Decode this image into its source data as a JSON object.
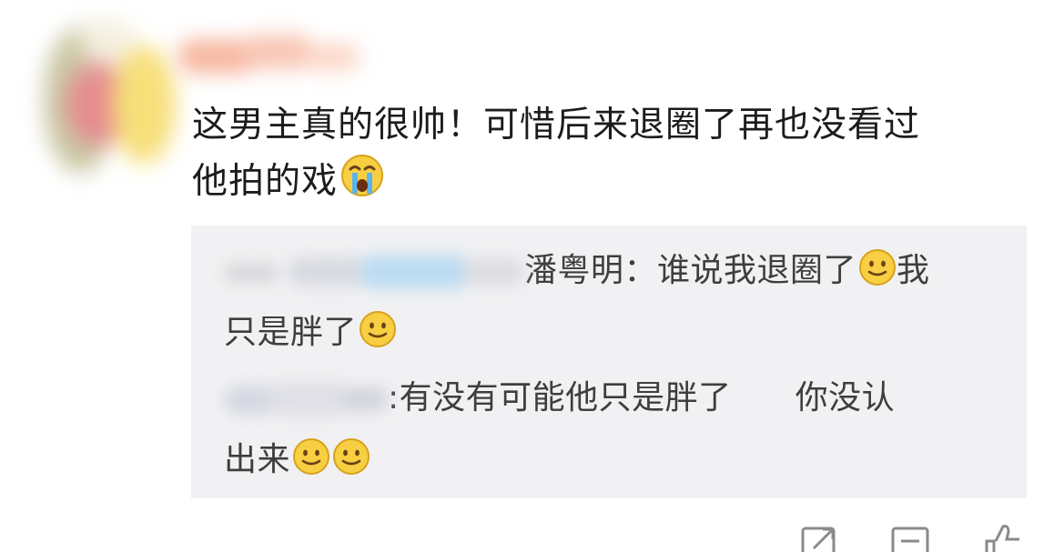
{
  "comment": {
    "text_line1": "这男主真的很帅！可惜后来退圈了再也没看过",
    "text_line2": "他拍的戏",
    "emoji": "crying-face"
  },
  "replies": [
    {
      "author": "潘粤明",
      "colon": "：",
      "text_a": "谁说我退圈了",
      "emoji_a": "smile",
      "text_b": "我",
      "text_c": "只是胖了",
      "emoji_b": "smile"
    },
    {
      "colon": ":",
      "text_a": "有没有可能他只是胖了",
      "text_b": "你没认",
      "text_c": "出来",
      "emoji_a": "smile",
      "emoji_b": "smile"
    }
  ],
  "actions": [
    "share-icon",
    "comment-icon",
    "like-icon"
  ],
  "colors": {
    "text_primary": "#1c1c1c",
    "text_reply": "#3e3e3e",
    "reply_bg": "#f1f1f3",
    "emoji_yellow": "#f8cf43"
  }
}
